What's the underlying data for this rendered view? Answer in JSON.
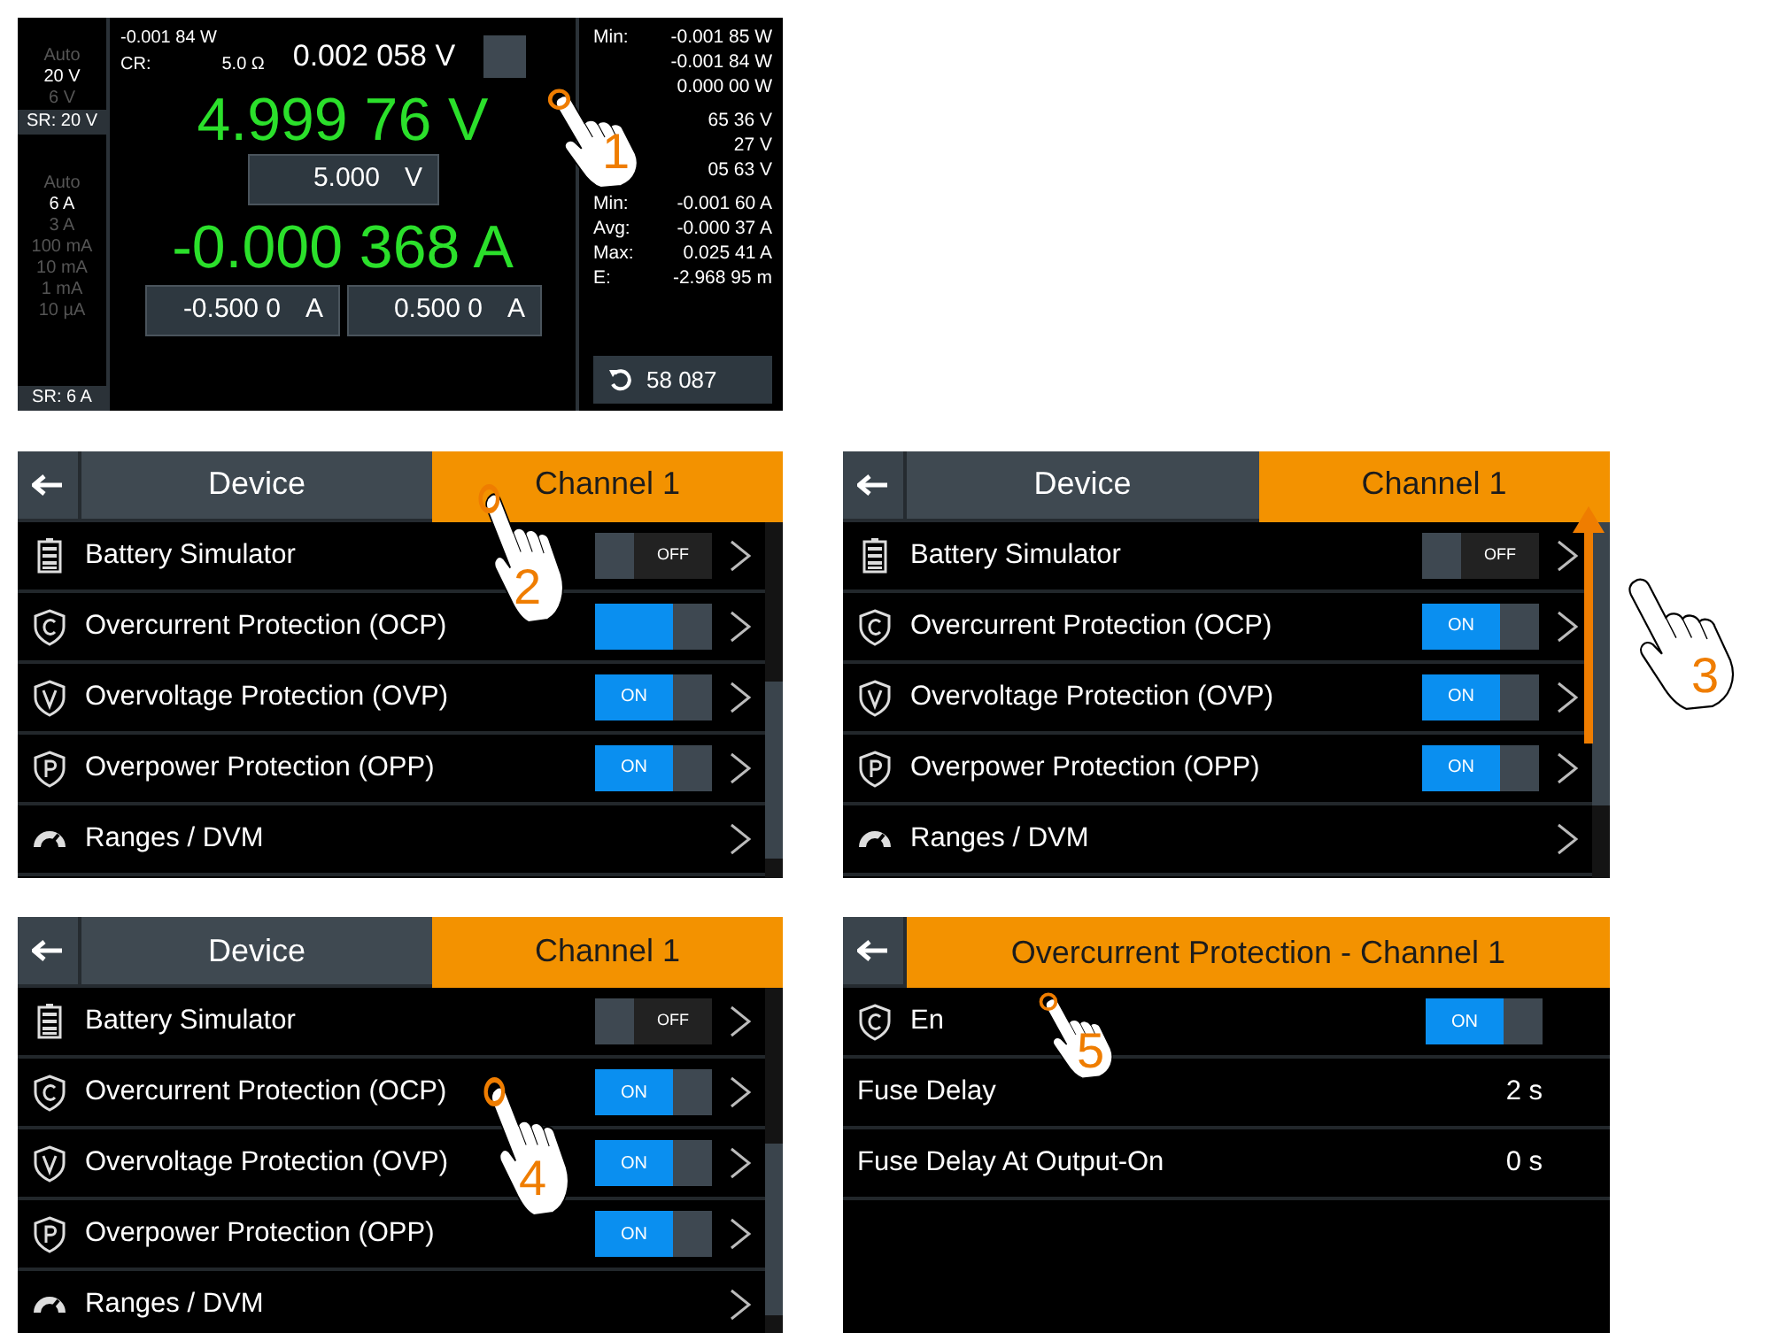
{
  "panels": [
    {
      "kind": "measurement",
      "gesture": {
        "kind": "tap",
        "step": "1"
      },
      "voltage_ranges": [
        {
          "label": "Auto",
          "selected": false
        },
        {
          "label": "20 V",
          "selected": true
        },
        {
          "label": "6 V",
          "selected": false
        }
      ],
      "voltage_sense_range": "SR: 20 V",
      "current_ranges": [
        {
          "label": "Auto",
          "selected": false
        },
        {
          "label": "6 A",
          "selected": true
        },
        {
          "label": "3 A",
          "selected": false
        },
        {
          "label": "100 mA",
          "selected": false
        },
        {
          "label": "10 mA",
          "selected": false
        },
        {
          "label": "1 mA",
          "selected": false
        },
        {
          "label": "10 µA",
          "selected": false
        }
      ],
      "current_sense_range": "SR: 6 A",
      "power": "-0.001 84 W",
      "cr_label": "CR:",
      "cr_value": "5.0 Ω",
      "secondary_voltage": "0.002 058 V",
      "voltage": "4.999 76 V",
      "voltage_setpoint": {
        "value": "5.000",
        "unit": "V"
      },
      "current": "-0.000 368 A",
      "current_limits": [
        {
          "value": "-0.500 0",
          "unit": "A"
        },
        {
          "value": "0.500 0",
          "unit": "A"
        }
      ],
      "power_stats": [
        {
          "label": "Min:",
          "value": "-0.001 85 W"
        },
        {
          "value": "-0.001 84 W"
        },
        {
          "value": "0.000 00 W"
        }
      ],
      "voltage_stats": [
        {
          "value": "65 36 V"
        },
        {
          "value": "27 V"
        },
        {
          "value": "05 63 V"
        }
      ],
      "current_stats": [
        {
          "label": "Min:",
          "value": "-0.001 60 A"
        },
        {
          "label": "Avg:",
          "value": "-0.000 37 A"
        },
        {
          "label": "Max:",
          "value": "0.025 41 A"
        },
        {
          "label": "E:",
          "value": "-2.968 95 m"
        }
      ],
      "counter": "58 087"
    },
    {
      "kind": "menu",
      "gesture": {
        "kind": "tap",
        "step": "2"
      },
      "tabs": [
        {
          "label": "Device",
          "selected": false
        },
        {
          "label": "Channel 1",
          "selected": true
        }
      ],
      "items": [
        {
          "label": "Battery Simulator",
          "on": false,
          "toggle_label": "OFF"
        },
        {
          "label": "Overcurrent Protection (OCP)",
          "on": true
        },
        {
          "label": "Overvoltage Protection (OVP)",
          "on": true,
          "toggle_label": "ON"
        },
        {
          "label": "Overpower Protection (OPP)",
          "on": true,
          "toggle_label": "ON"
        },
        {
          "label": "Ranges / DVM"
        }
      ]
    },
    {
      "kind": "menu",
      "gesture": {
        "kind": "swipe",
        "step": "3"
      },
      "tabs": [
        {
          "label": "Device",
          "selected": false
        },
        {
          "label": "Channel 1",
          "selected": true
        }
      ],
      "items": [
        {
          "label": "Battery Simulator",
          "on": false,
          "toggle_label": "OFF"
        },
        {
          "label": "Overcurrent Protection (OCP)",
          "on": true,
          "toggle_label": "ON"
        },
        {
          "label": "Overvoltage Protection (OVP)",
          "on": true,
          "toggle_label": "ON"
        },
        {
          "label": "Overpower Protection (OPP)",
          "on": true,
          "toggle_label": "ON"
        },
        {
          "label": "Ranges / DVM"
        }
      ]
    },
    {
      "kind": "menu",
      "gesture": {
        "kind": "tap",
        "step": "4"
      },
      "tabs": [
        {
          "label": "Device",
          "selected": false
        },
        {
          "label": "Channel 1",
          "selected": true
        }
      ],
      "items": [
        {
          "label": "Battery Simulator",
          "on": false,
          "toggle_label": "OFF"
        },
        {
          "label": "Overcurrent Protection (OCP)",
          "on": true,
          "toggle_label": "ON"
        },
        {
          "label": "Overvoltage Protection (OVP)",
          "on": true,
          "toggle_label": "ON"
        },
        {
          "label": "Overpower Protection (OPP)",
          "on": true,
          "toggle_label": "ON"
        },
        {
          "label": "Ranges / DVM"
        }
      ]
    },
    {
      "kind": "settings",
      "gesture": {
        "kind": "tap",
        "step": "5"
      },
      "title": "Overcurrent Protection - Channel 1",
      "rows": [
        {
          "label": "En",
          "on": true,
          "toggle_label": "ON"
        },
        {
          "label": "Fuse Delay",
          "value": "2 s"
        },
        {
          "label": "Fuse Delay At Output-On",
          "value": "0 s"
        }
      ]
    }
  ]
}
